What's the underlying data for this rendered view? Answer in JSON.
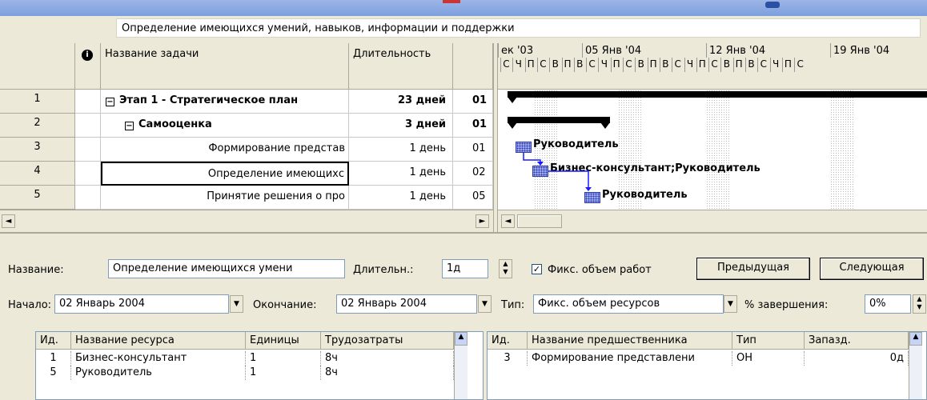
{
  "entry_bar": {
    "value": "Определение имеющихся умений, навыков, информации и поддержки"
  },
  "gantt_table": {
    "headers": {
      "info_icon": "i",
      "task_name": "Название задачи",
      "duration": "Длительность"
    },
    "rows": [
      {
        "id": "1",
        "name": "Этап 1 - Стратегическое план",
        "duration": "23 дней",
        "start": "01",
        "level": 0,
        "summary": true
      },
      {
        "id": "2",
        "name": "Самооценка",
        "duration": "3 дней",
        "start": "01",
        "level": 1,
        "summary": true
      },
      {
        "id": "3",
        "name": "Формирование представ",
        "duration": "1 день",
        "start": "01",
        "level": 2,
        "summary": false
      },
      {
        "id": "4",
        "name": "Определение имеющихс",
        "duration": "1 день",
        "start": "02",
        "level": 2,
        "summary": false,
        "selected": true
      },
      {
        "id": "5",
        "name": "Принятие решения о про",
        "duration": "1 день",
        "start": "05",
        "level": 2,
        "summary": false
      }
    ],
    "collapse_glyph": "−"
  },
  "timescale": {
    "weeks": [
      "ек '03",
      "05 Янв '04",
      "12 Янв '04",
      "19 Янв '04"
    ],
    "days": [
      "С",
      "Ч",
      "П",
      "С",
      "В",
      "П",
      "В",
      "С",
      "Ч",
      "П",
      "С",
      "В",
      "П",
      "В",
      "С",
      "Ч",
      "П",
      "С",
      "В",
      "П",
      "В",
      "С",
      "Ч",
      "П",
      "С"
    ]
  },
  "gantt_bars": {
    "labels": [
      "Руководитель",
      "Бизнес-консультант;Руководитель",
      "Руководитель"
    ]
  },
  "scroll": {
    "left": "◄",
    "right": "►"
  },
  "form": {
    "name_label": "Название:",
    "name_value": "Определение имеющихся умени",
    "duration_label": "Длительн.:",
    "duration_value": "1д",
    "fixed_work_label": "Фикс. объем работ",
    "fixed_work_checked": "✓",
    "prev_button": "Предыдущая",
    "next_button": "Следующая",
    "start_label": "Начало:",
    "start_value": "02 Январь 2004",
    "finish_label": "Окончание:",
    "finish_value": "02 Январь 2004",
    "type_label": "Тип:",
    "type_value": "Фикс. объем ресурсов",
    "complete_label": "% завершения:",
    "complete_value": "0%"
  },
  "resources_table": {
    "headers": [
      "Ид.",
      "Название ресурса",
      "Единицы",
      "Трудозатраты"
    ],
    "rows": [
      [
        "1",
        "Бизнес-консультант",
        "1",
        "8ч"
      ],
      [
        "5",
        "Руководитель",
        "1",
        "8ч"
      ]
    ]
  },
  "predecessors_table": {
    "headers": [
      "Ид.",
      "Название предшественника",
      "Тип",
      "Запазд."
    ],
    "rows": [
      [
        "3",
        "Формирование представлени",
        "ОН",
        "0д"
      ]
    ]
  }
}
